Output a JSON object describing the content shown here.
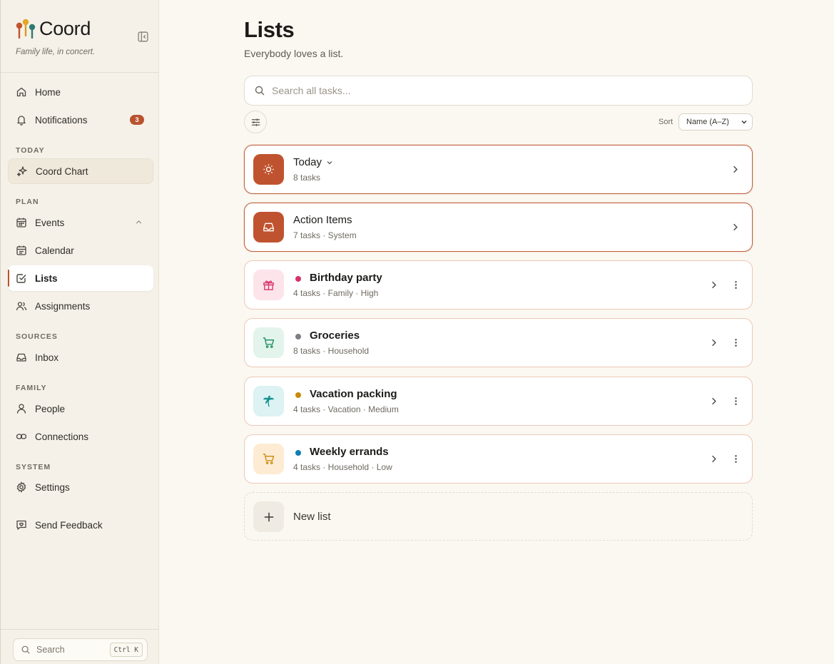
{
  "brand": {
    "name": "Coord",
    "tagline": "Family life, in concert."
  },
  "nav": {
    "home": "Home",
    "notifications": "Notifications",
    "notifications_badge": "3",
    "section_today": "TODAY",
    "coord_chart": "Coord Chart",
    "section_plan": "PLAN",
    "events": "Events",
    "calendar": "Calendar",
    "lists": "Lists",
    "assignments": "Assignments",
    "section_sources": "SOURCES",
    "inbox": "Inbox",
    "section_family": "FAMILY",
    "people": "People",
    "connections": "Connections",
    "section_system": "SYSTEM",
    "settings": "Settings",
    "feedback": "Send Feedback"
  },
  "sidebar_search": {
    "placeholder": "Search",
    "shortcut": "Ctrl K"
  },
  "page": {
    "title": "Lists",
    "subtitle": "Everybody loves a list.",
    "search_placeholder": "Search all tasks...",
    "sort_label": "Sort",
    "sort_value": "Name (A–Z)"
  },
  "lists": [
    {
      "name": "Today",
      "meta": "8 tasks",
      "icon": "sun-icon",
      "tile_color": "#c0532f"
    },
    {
      "name": "Action Items",
      "meta": "7 tasks · System",
      "icon": "inbox-icon",
      "tile_color": "#c0532f"
    },
    {
      "name": "Birthday party",
      "meta": "4 tasks · Family · High",
      "icon": "gift-icon",
      "dot_color": "#d6336c",
      "tile_color": "#fde4ea"
    },
    {
      "name": "Groceries",
      "meta": "8 tasks · Household",
      "icon": "cart-icon",
      "dot_color": "#7c7f86",
      "tile_color": "#e2f4ec"
    },
    {
      "name": "Vacation packing",
      "meta": "4 tasks · Vacation · Medium",
      "icon": "palm-tree-icon",
      "dot_color": "#c98a0a",
      "tile_color": "#dcf2f3"
    },
    {
      "name": "Weekly errands",
      "meta": "4 tasks · Household · Low",
      "icon": "cart-icon",
      "dot_color": "#0e7fb5",
      "tile_color": "#fdebd3"
    }
  ],
  "new_list": {
    "label": "New list"
  }
}
